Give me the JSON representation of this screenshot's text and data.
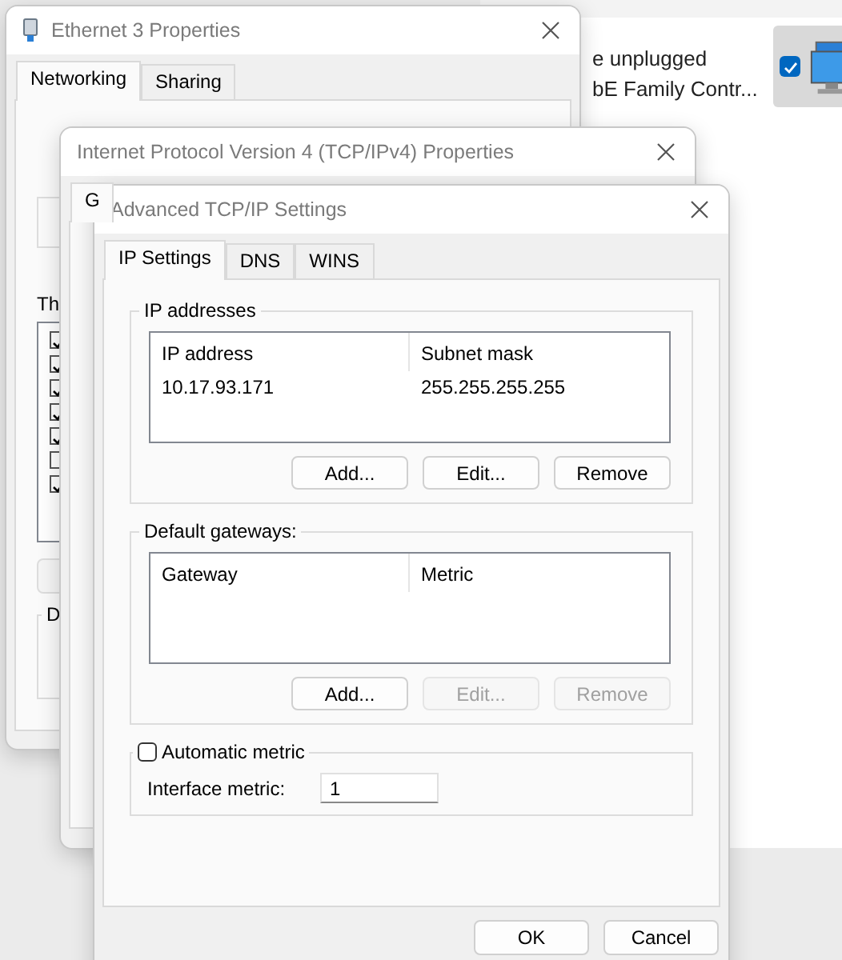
{
  "background_window": {
    "lines": [
      "e unplugged",
      "bE Family Contr..."
    ],
    "checked": true
  },
  "ethernet_window": {
    "title": "Ethernet 3 Properties",
    "tabs": [
      {
        "label": "Networking",
        "selected": true
      },
      {
        "label": "Sharing",
        "selected": false
      }
    ],
    "list_label": "Th",
    "components": [
      {
        "checked": true
      },
      {
        "checked": true
      },
      {
        "checked": true
      },
      {
        "checked": true
      },
      {
        "checked": true
      },
      {
        "checked": false
      },
      {
        "checked": true
      }
    ],
    "group_label": "D"
  },
  "ipv4_window": {
    "title": "Internet Protocol Version 4 (TCP/IPv4) Properties",
    "tabs": [
      {
        "label": "G",
        "selected": true
      }
    ]
  },
  "advanced_window": {
    "title": "Advanced TCP/IP Settings",
    "tabs": [
      {
        "label": "IP Settings",
        "selected": true
      },
      {
        "label": "DNS",
        "selected": false
      },
      {
        "label": "WINS",
        "selected": false
      }
    ],
    "ip_addresses": {
      "label": "IP addresses",
      "columns": [
        "IP address",
        "Subnet mask"
      ],
      "rows": [
        [
          "10.17.93.171",
          "255.255.255.255"
        ]
      ],
      "buttons": [
        {
          "label": "Add...",
          "disabled": false
        },
        {
          "label": "Edit...",
          "disabled": false
        },
        {
          "label": "Remove",
          "disabled": false
        }
      ]
    },
    "default_gateways": {
      "label": "Default gateways:",
      "columns": [
        "Gateway",
        "Metric"
      ],
      "buttons": [
        {
          "label": "Add...",
          "disabled": false
        },
        {
          "label": "Edit...",
          "disabled": true
        },
        {
          "label": "Remove",
          "disabled": true
        }
      ]
    },
    "automatic_metric": {
      "label": "Automatic metric",
      "checked": false
    },
    "interface_metric": {
      "label": "Interface metric:",
      "value": "1"
    },
    "buttons": [
      "OK",
      "Cancel"
    ]
  }
}
